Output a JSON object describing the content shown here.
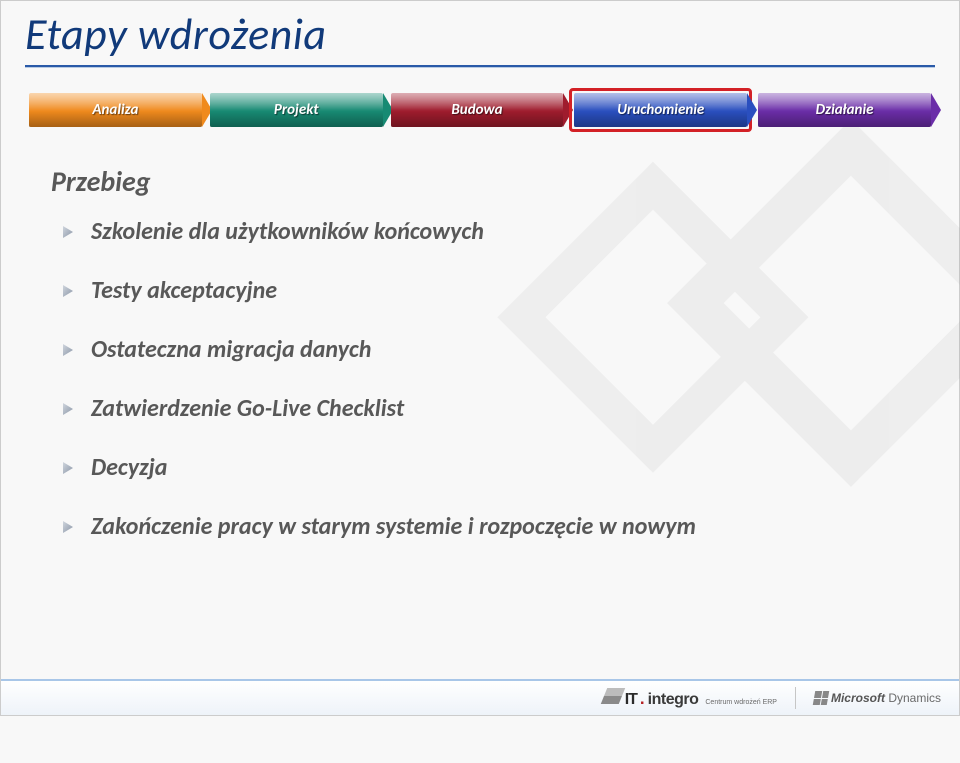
{
  "title": "Etapy wdrożenia",
  "stages": [
    {
      "label": "Analiza",
      "active": false
    },
    {
      "label": "Projekt",
      "active": false
    },
    {
      "label": "Budowa",
      "active": false
    },
    {
      "label": "Uruchomienie",
      "active": true
    },
    {
      "label": "Działanie",
      "active": false
    }
  ],
  "subheading": "Przebieg",
  "bullets": [
    "Szkolenie dla użytkowników końcowych",
    "Testy akceptacyjne",
    "Ostateczna migracja danych",
    "Zatwierdzenie Go-Live Checklist",
    "Decyzja",
    "Zakończenie pracy w starym systemie i rozpoczęcie w nowym"
  ],
  "footer": {
    "integro_it": "IT",
    "integro_name": "integro",
    "integro_tag": "Centrum wdrożeń ERP",
    "ms_brand": "Microsoft",
    "ms_product": "Dynamics"
  }
}
